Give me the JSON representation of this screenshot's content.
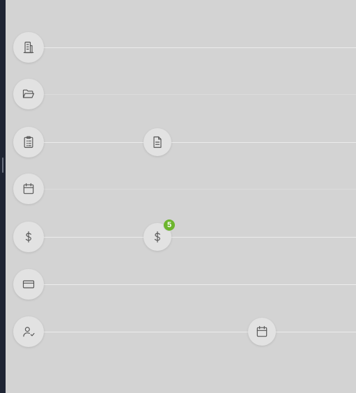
{
  "nav_icons": [
    {
      "name": "building-icon"
    },
    {
      "name": "folder-open-icon"
    },
    {
      "name": "clipboard-list-icon"
    },
    {
      "name": "calendar-icon"
    },
    {
      "name": "dollar-icon"
    },
    {
      "name": "credit-card-icon"
    },
    {
      "name": "user-check-icon"
    }
  ],
  "timeline_nodes": [
    {
      "name": "document-icon"
    },
    {
      "name": "dollar-icon",
      "badge": "5"
    },
    {
      "name": "calendar-icon"
    }
  ],
  "colors": {
    "background": "#d3d3d3",
    "sidebar_edge": "#1e2433",
    "circle": "#e2e2e2",
    "icon_stroke": "#555555",
    "badge": "#6cb52d"
  }
}
